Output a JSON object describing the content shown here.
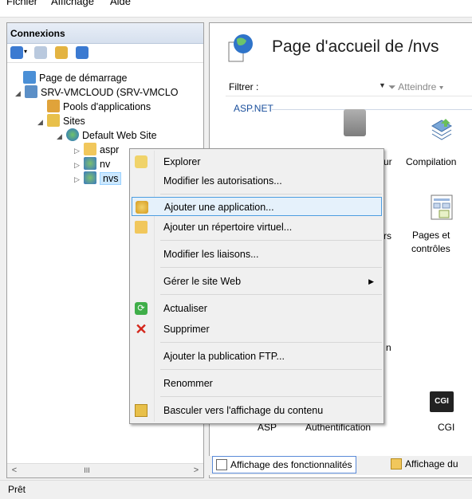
{
  "menubar": {
    "items": [
      "Fichier",
      "Affichage",
      "Aide"
    ]
  },
  "connections": {
    "title": "Connexions",
    "tree": [
      {
        "label": "Page de démarrage",
        "icon": "start-page-icon"
      },
      {
        "label": "SRV-VMCLOUD (SRV-VMCLO",
        "icon": "server-icon"
      },
      {
        "label": "Pools d'applications",
        "icon": "app-pool-icon"
      },
      {
        "label": "Sites",
        "icon": "sites-folder-icon"
      },
      {
        "label": "Default Web Site",
        "icon": "globe-icon"
      },
      {
        "label": "aspr",
        "icon": "folder-icon"
      },
      {
        "label": "nv",
        "icon": "application-icon"
      },
      {
        "label": "nvs",
        "icon": "application-icon"
      }
    ],
    "scroll_thumb": "III"
  },
  "main": {
    "title": "Page d'accueil de /nvs",
    "filter_label": "Filtrer :",
    "goto_label": "Atteindre",
    "group": "ASP.NET",
    "features": {
      "f1": "ur",
      "f2": "Compilation",
      "f3": "rs",
      "f4_line1": "Pages et",
      "f4_line2": "contrôles",
      "f5": "n",
      "cgi_badge": "CGI",
      "f6": "ASP",
      "f7": "Authentification",
      "f8": "CGI"
    }
  },
  "tabs": {
    "features_view": "Affichage des fonctionnalités",
    "content_view": "Affichage du"
  },
  "status": {
    "text": "Prêt"
  },
  "context_menu": {
    "explore": "Explorer",
    "edit_permissions": "Modifier les autorisations...",
    "add_application": "Ajouter une application...",
    "add_virtual_dir": "Ajouter un répertoire virtuel...",
    "edit_bindings": "Modifier les liaisons...",
    "manage_site": "Gérer le site Web",
    "refresh": "Actualiser",
    "remove": "Supprimer",
    "add_ftp": "Ajouter la publication FTP...",
    "rename": "Renommer",
    "switch_content_view": "Basculer vers l'affichage du contenu"
  },
  "colors": {
    "selection": "#cce8ff",
    "menu_highlight": "#e5f1fb",
    "accent": "#1a4f9c",
    "delete_red": "#d4261b"
  }
}
